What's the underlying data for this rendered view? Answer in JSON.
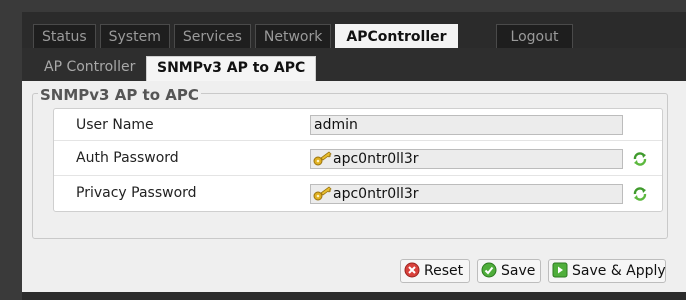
{
  "main_tabs": [
    {
      "label": "Status"
    },
    {
      "label": "System"
    },
    {
      "label": "Services"
    },
    {
      "label": "Network"
    },
    {
      "label": "APController"
    },
    {
      "label": "Logout"
    }
  ],
  "sub_tabs": [
    {
      "label": "AP Controller"
    },
    {
      "label": "SNMPv3 AP to APC"
    }
  ],
  "section": {
    "legend": "SNMPv3 AP to APC"
  },
  "fields": [
    {
      "label": "User Name",
      "value": "admin"
    },
    {
      "label": "Auth Password",
      "value": "apc0ntr0ll3r",
      "icon": "key-icon",
      "action_icon": "reveal-password-icon"
    },
    {
      "label": "Privacy Password",
      "value": "apc0ntr0ll3r",
      "icon": "key-icon",
      "action_icon": "reveal-password-icon"
    }
  ],
  "buttons": {
    "reset": "Reset",
    "save": "Save",
    "save_apply": "Save & Apply"
  },
  "colors": {
    "background": "#3a3a3a",
    "panel": "#efefef",
    "active_tab": "#f3f3f3"
  }
}
